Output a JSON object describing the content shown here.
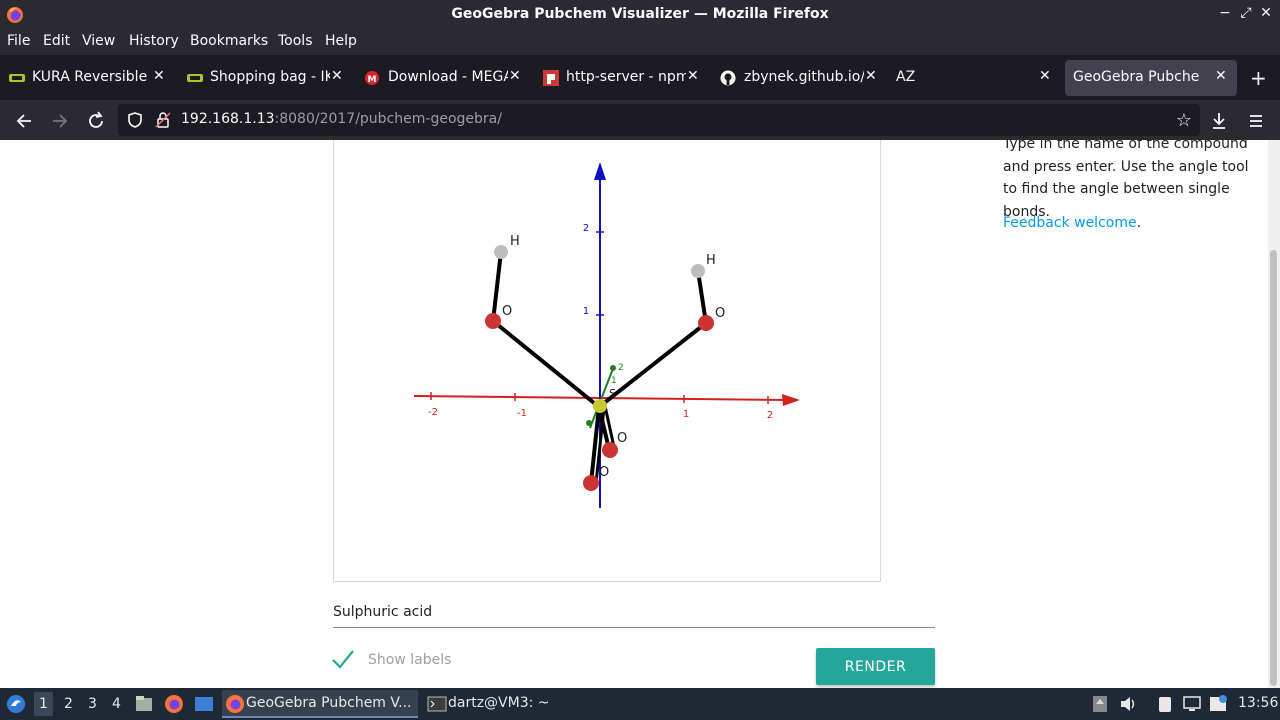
{
  "window": {
    "title": "GeoGebra Pubchem Visualizer — Mozilla Firefox",
    "controls": [
      "−",
      "⤢",
      "✕"
    ]
  },
  "menu": [
    "File",
    "Edit",
    "View",
    "History",
    "Bookmarks",
    "Tools",
    "Help"
  ],
  "tabs": [
    {
      "label": "KURA Reversible b",
      "icon": "ikea-icon"
    },
    {
      "label": "Shopping bag - IK",
      "icon": "ikea-icon"
    },
    {
      "label": "Download - MEGA",
      "icon": "mega-icon"
    },
    {
      "label": "http-server - npm",
      "icon": "npm-icon"
    },
    {
      "label": "zbynek.github.io/p",
      "icon": "github-icon"
    },
    {
      "label": "AZ",
      "icon": ""
    },
    {
      "label": "GeoGebra Pubchem V",
      "icon": "",
      "active": true
    }
  ],
  "address": {
    "host": "192.168.1.13",
    "rest": ":8080/2017/pubchem-geogebra/"
  },
  "page": {
    "instructions": "Type in the name of the compound and press enter. Use the angle tool to find the angle between single bonds.",
    "feedback_link": "Feedback welcome",
    "feedback_suffix": ".",
    "compound_value": "Sulphuric acid",
    "show_labels": "Show labels",
    "show_labels_checked": true,
    "render_button": "RENDER"
  },
  "molecule": {
    "atoms": [
      {
        "label": "H",
        "kind": "H"
      },
      {
        "label": "O",
        "kind": "O"
      },
      {
        "label": "H",
        "kind": "H"
      },
      {
        "label": "O",
        "kind": "O"
      },
      {
        "label": "S",
        "kind": "S"
      },
      {
        "label": "O",
        "kind": "O"
      },
      {
        "label": "O",
        "kind": "O"
      }
    ],
    "x_ticks": [
      "-2",
      "-1",
      "1",
      "2"
    ],
    "y_ticks": [
      "1",
      "2"
    ],
    "z_ticks": [
      "1",
      "2"
    ],
    "colors": {
      "x_axis": "#d32020",
      "y_axis": "#1010c0",
      "z_axis": "#208020",
      "oxygen": "#cc3333",
      "hydrogen": "#bdbdbd",
      "sulfur": "#c8c832"
    }
  },
  "taskbar": {
    "workspaces": [
      "1",
      "2",
      "3",
      "4"
    ],
    "tasks": [
      {
        "label": "GeoGebra Pubchem V...",
        "icon": "firefox-icon",
        "active": true
      },
      {
        "label": "dartz@VM3: ~",
        "icon": "terminal-icon",
        "active": false
      }
    ],
    "clock": "13:56"
  }
}
